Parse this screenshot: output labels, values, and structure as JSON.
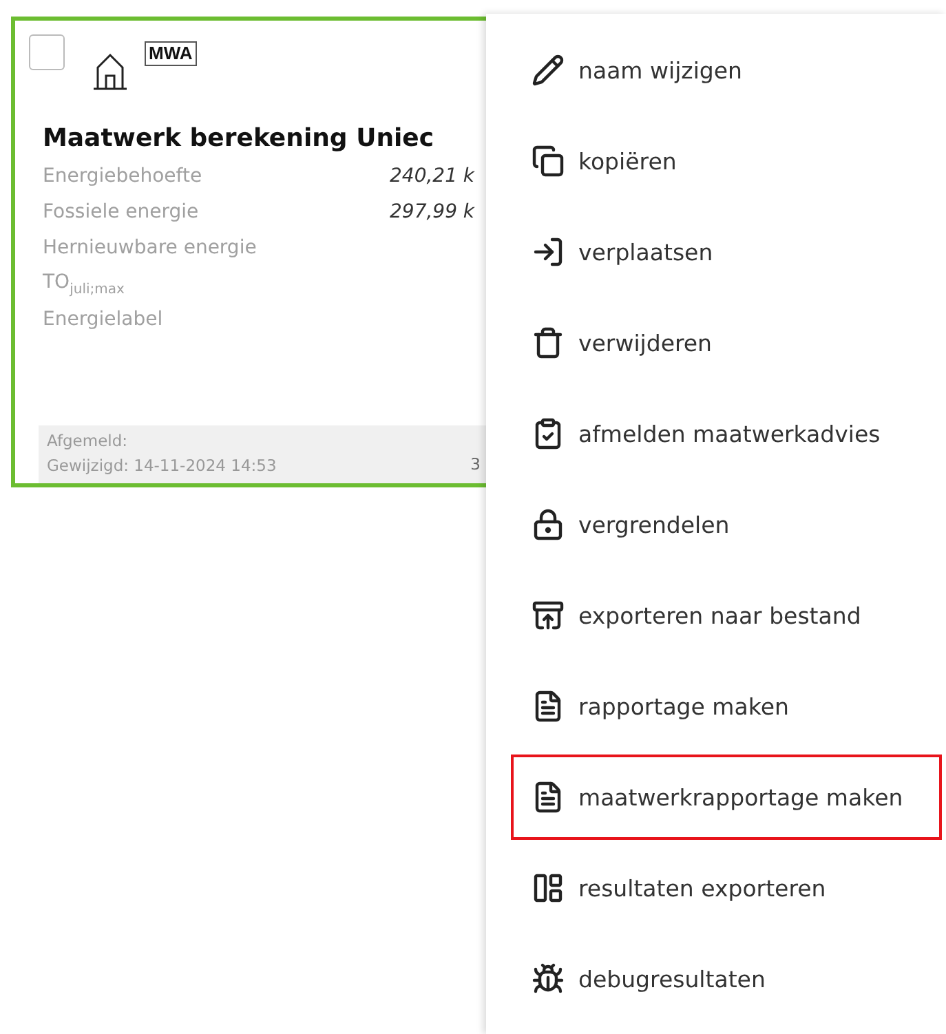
{
  "card": {
    "checked": false,
    "badge": "MWA",
    "title": "Maatwerk berekening Uniec",
    "rows": [
      {
        "label": "Energiebehoefte",
        "value": "240,21 k"
      },
      {
        "label": "Fossiele energie",
        "value": "297,99 k"
      },
      {
        "label": "Hernieuwbare energie"
      },
      {
        "label": "TO$_{juli;max}$"
      },
      {
        "label": "Energielabel"
      }
    ],
    "footer": {
      "status": "Afgemeld:",
      "modified": "Gewijzigd: 14-11-2024 14:53",
      "extra": "3"
    }
  },
  "menu": [
    {
      "label": "naam wijzigen",
      "highlighted": false
    },
    {
      "label": "kopiëren",
      "highlighted": false
    },
    {
      "label": "verplaatsen",
      "highlighted": false
    },
    {
      "label": "verwijderen",
      "highlighted": false
    },
    {
      "label": "afmelden maatwerkadvies",
      "highlighted": false
    },
    {
      "label": "vergrendelen",
      "highlighted": false
    },
    {
      "label": "exporteren naar bestand",
      "highlighted": false
    },
    {
      "label": "rapportage maken",
      "highlighted": false
    },
    {
      "label": "maatwerkrapportage maken",
      "highlighted": true
    },
    {
      "label": "resultaten exporteren",
      "highlighted": false
    },
    {
      "label": "debugresultaten",
      "highlighted": false
    }
  ]
}
